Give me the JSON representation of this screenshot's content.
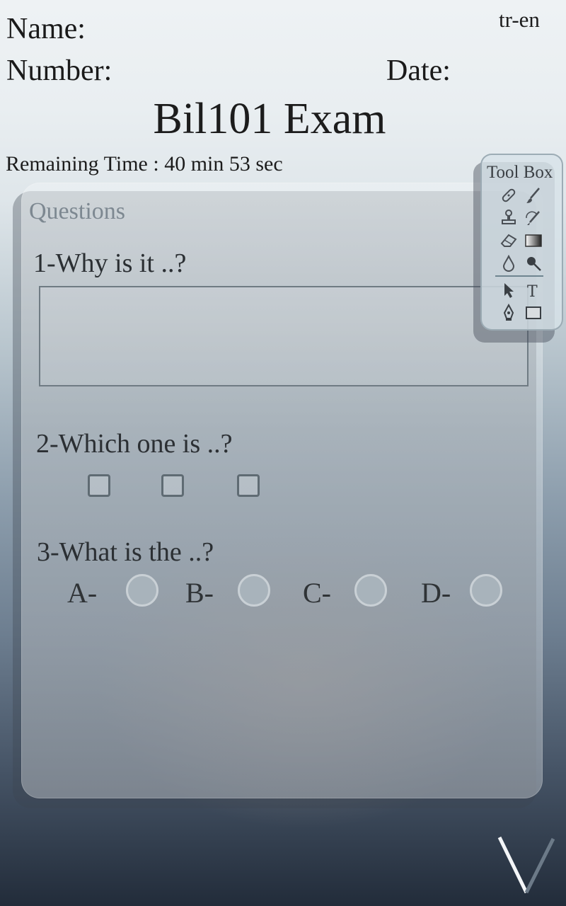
{
  "header": {
    "name_label": "Name:",
    "number_label": "Number:",
    "date_label": "Date:",
    "language_toggle": "tr-en"
  },
  "exam": {
    "title": "Bil101 Exam",
    "remaining_time": "Remaining Time : 40 min 53 sec"
  },
  "questions_panel": {
    "label": "Questions",
    "q1": {
      "text": "1-Why is it ..?",
      "answer_value": ""
    },
    "q2": {
      "text": "2-Which one is ..?",
      "checkbox_count": 3
    },
    "q3": {
      "text": "3-What is the ..?",
      "options": [
        "A-",
        "B-",
        "C-",
        "D-"
      ]
    }
  },
  "toolbox": {
    "title": "Tool Box",
    "tools": [
      "bandage-icon",
      "brush-icon",
      "stamp-icon",
      "history-brush-icon",
      "eraser-icon",
      "gradient-icon",
      "blur-drop-icon",
      "dodge-icon",
      "pointer-icon",
      "text-tool-icon",
      "pen-icon",
      "rectangle-icon"
    ]
  },
  "colors": {
    "text": "#1c1c1c",
    "panel_label": "#7d8891",
    "radio_fill": "#a8b3bb"
  }
}
